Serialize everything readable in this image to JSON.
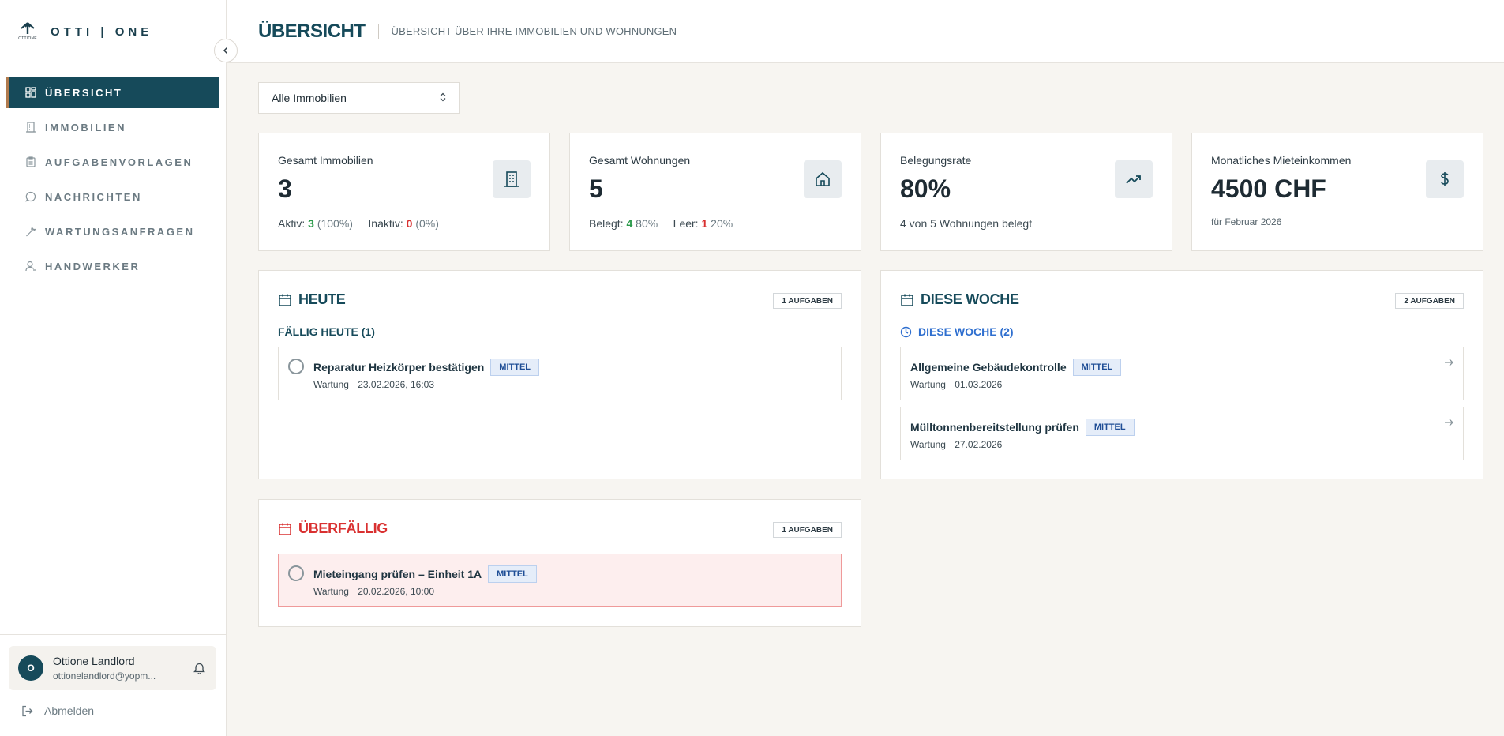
{
  "brand": {
    "logo_text": "OTTIONE",
    "name": "OTTI | ONE"
  },
  "sidebar": {
    "items": [
      {
        "label": "ÜBERSICHT",
        "icon": "dashboard-icon",
        "active": true
      },
      {
        "label": "IMMOBILIEN",
        "icon": "building-icon",
        "active": false
      },
      {
        "label": "AUFGABENVORLAGEN",
        "icon": "clipboard-icon",
        "active": false
      },
      {
        "label": "NACHRICHTEN",
        "icon": "chat-icon",
        "active": false
      },
      {
        "label": "WARTUNGSANFRAGEN",
        "icon": "wrench-icon",
        "active": false
      },
      {
        "label": "HANDWERKER",
        "icon": "user-icon",
        "active": false
      }
    ],
    "user": {
      "initial": "O",
      "name": "Ottione Landlord",
      "email": "ottionelandlord@yopm..."
    },
    "logout_label": "Abmelden"
  },
  "header": {
    "title": "ÜBERSICHT",
    "subtitle": "Übersicht über Ihre Immobilien und Wohnungen"
  },
  "filter": {
    "selected": "Alle Immobilien"
  },
  "stats": {
    "immobilien": {
      "label": "Gesamt Immobilien",
      "value": "3",
      "aktiv_label": "Aktiv:",
      "aktiv_count": "3",
      "aktiv_pct": "(100%)",
      "inaktiv_label": "Inaktiv:",
      "inaktiv_count": "0",
      "inaktiv_pct": "(0%)"
    },
    "wohnungen": {
      "label": "Gesamt Wohnungen",
      "value": "5",
      "belegt_label": "Belegt:",
      "belegt_count": "4",
      "belegt_pct": "80%",
      "leer_label": "Leer:",
      "leer_count": "1",
      "leer_pct": "20%"
    },
    "belegung": {
      "label": "Belegungsrate",
      "value": "80%",
      "sub": "4 von 5 Wohnungen belegt"
    },
    "einkommen": {
      "label": "Monatliches Mieteinkommen",
      "value": "4500 CHF",
      "sub": "für Februar 2026"
    }
  },
  "heute": {
    "title": "HEUTE",
    "badge": "1 AUFGABEN",
    "group": "FÄLLIG HEUTE (1)",
    "tasks": [
      {
        "title": "Reparatur Heizkörper bestätigen",
        "priority": "MITTEL",
        "category": "Wartung",
        "date": "23.02.2026, 16:03"
      }
    ]
  },
  "woche": {
    "title": "DIESE WOCHE",
    "badge": "2 AUFGABEN",
    "group": "DIESE WOCHE (2)",
    "tasks": [
      {
        "title": "Allgemeine Gebäudekontrolle",
        "priority": "MITTEL",
        "category": "Wartung",
        "date": "01.03.2026"
      },
      {
        "title": "Mülltonnenbereitstellung prüfen",
        "priority": "MITTEL",
        "category": "Wartung",
        "date": "27.02.2026"
      }
    ]
  },
  "ueberfaellig": {
    "title": "ÜBERFÄLLIG",
    "badge": "1 AUFGABEN",
    "tasks": [
      {
        "title": "Mieteingang prüfen – Einheit 1A",
        "priority": "MITTEL",
        "category": "Wartung",
        "date": "20.02.2026, 10:00"
      }
    ]
  },
  "colors": {
    "primary": "#164a5a",
    "accent": "#b07a4d",
    "danger": "#d93030",
    "success": "#2a9a4a",
    "info": "#2f6fcf"
  }
}
